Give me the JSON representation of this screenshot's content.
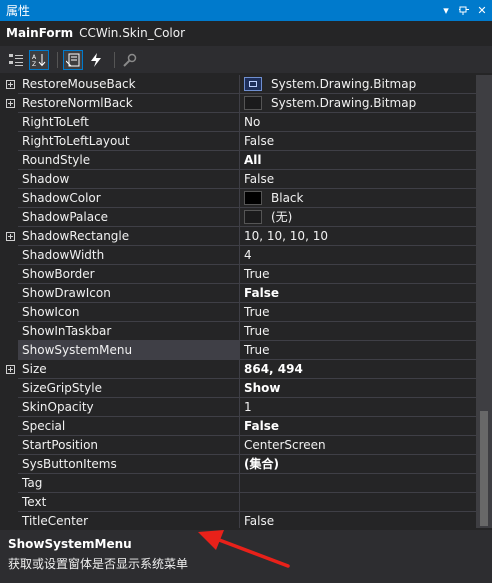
{
  "window": {
    "title": "属性"
  },
  "object": {
    "name": "MainForm",
    "type": "CCWin.Skin_Color"
  },
  "toolbar": {
    "icons": [
      "categorized-icon",
      "alphabetical-icon",
      "properties-icon",
      "events-icon",
      "property-pages-icon"
    ]
  },
  "properties": [
    {
      "name": "RestoreMouseBack",
      "value": "System.Drawing.Bitmap",
      "expand": true,
      "swatch": "image"
    },
    {
      "name": "RestoreNormlBack",
      "value": "System.Drawing.Bitmap",
      "expand": true,
      "swatch": "empty"
    },
    {
      "name": "RightToLeft",
      "value": "No"
    },
    {
      "name": "RightToLeftLayout",
      "value": "False"
    },
    {
      "name": "RoundStyle",
      "value": "All",
      "bold": true
    },
    {
      "name": "Shadow",
      "value": "False"
    },
    {
      "name": "ShadowColor",
      "value": "Black",
      "swatch": "#000000"
    },
    {
      "name": "ShadowPalace",
      "value": "(无)",
      "swatch": "empty"
    },
    {
      "name": "ShadowRectangle",
      "value": "10, 10, 10, 10",
      "expand": true
    },
    {
      "name": "ShadowWidth",
      "value": "4"
    },
    {
      "name": "ShowBorder",
      "value": "True"
    },
    {
      "name": "ShowDrawIcon",
      "value": "False",
      "bold": true
    },
    {
      "name": "ShowIcon",
      "value": "True"
    },
    {
      "name": "ShowInTaskbar",
      "value": "True"
    },
    {
      "name": "ShowSystemMenu",
      "value": "True",
      "selected": true
    },
    {
      "name": "Size",
      "value": "864, 494",
      "expand": true,
      "bold": true
    },
    {
      "name": "SizeGripStyle",
      "value": "Show",
      "bold": true
    },
    {
      "name": "SkinOpacity",
      "value": "1"
    },
    {
      "name": "Special",
      "value": "False",
      "bold": true
    },
    {
      "name": "StartPosition",
      "value": "CenterScreen"
    },
    {
      "name": "SysButtonItems",
      "value": "(集合)",
      "bold": true
    },
    {
      "name": "Tag",
      "value": ""
    },
    {
      "name": "Text",
      "value": ""
    },
    {
      "name": "TitleCenter",
      "value": "False"
    }
  ],
  "description": {
    "name": "ShowSystemMenu",
    "text": "获取或设置窗体是否显示系统菜单"
  },
  "colors": {
    "accent": "#007acc",
    "arrow": "#e8211a",
    "background": "#252526"
  }
}
